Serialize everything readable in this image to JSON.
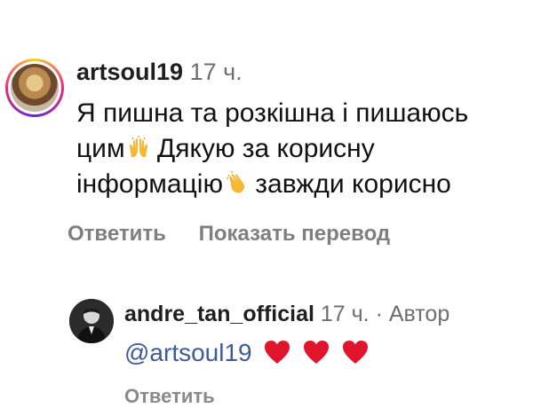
{
  "comment": {
    "username": "artsoul19",
    "time": "17 ч.",
    "text_line1": "Я пишна та розкішна і пишаюсь",
    "text_line2": "цим",
    "text_line2b": " Дякую за корисну",
    "text_line3": "інформацію",
    "text_line3b": " завжди корисно",
    "reply_label": "Ответить",
    "translate_label": "Показать перевод"
  },
  "reply": {
    "username": "andre_tan_official",
    "time": "17 ч. · Автор",
    "mention": "@artsoul19",
    "hearts": 3,
    "reply_label": "Ответить"
  },
  "icons": {
    "emoji1": "raising-hands-emoji",
    "emoji2": "clapping-hands-emoji",
    "heart": "red-heart-emoji"
  },
  "colors": {
    "mention": "#3d5a99",
    "meta_text": "#6e6e6e",
    "actions_text": "#7f7f7f",
    "heart": "#e0142b"
  }
}
